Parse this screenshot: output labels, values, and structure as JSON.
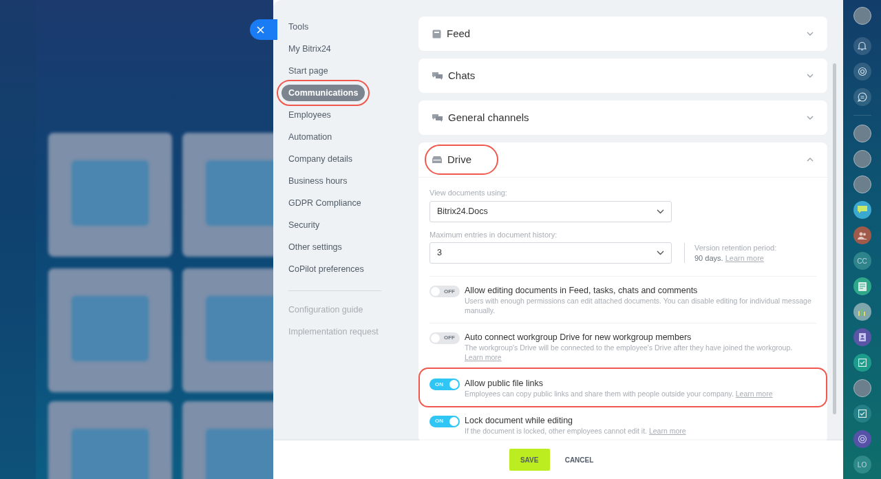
{
  "nav": {
    "items": [
      {
        "label": "Tools",
        "selected": false,
        "highlighted": false
      },
      {
        "label": "My Bitrix24",
        "selected": false,
        "highlighted": false
      },
      {
        "label": "Start page",
        "selected": false,
        "highlighted": false
      },
      {
        "label": "Communications",
        "selected": true,
        "highlighted": true
      },
      {
        "label": "Employees",
        "selected": false,
        "highlighted": false
      },
      {
        "label": "Automation",
        "selected": false,
        "highlighted": false
      },
      {
        "label": "Company details",
        "selected": false,
        "highlighted": false
      },
      {
        "label": "Business hours",
        "selected": false,
        "highlighted": false
      },
      {
        "label": "GDPR Compliance",
        "selected": false,
        "highlighted": false
      },
      {
        "label": "Security",
        "selected": false,
        "highlighted": false
      },
      {
        "label": "Other settings",
        "selected": false,
        "highlighted": false
      },
      {
        "label": "CoPilot preferences",
        "selected": false,
        "highlighted": false
      }
    ],
    "secondary": [
      "Configuration guide",
      "Implementation request"
    ]
  },
  "sections": [
    {
      "title": "Feed",
      "expanded": false,
      "highlighted": false
    },
    {
      "title": "Chats",
      "expanded": false,
      "highlighted": false
    },
    {
      "title": "General channels",
      "expanded": false,
      "highlighted": false
    },
    {
      "title": "Drive",
      "expanded": true,
      "highlighted": true,
      "body": {
        "fields": [
          {
            "label": "View documents using:",
            "value": "Bitrix24.Docs"
          },
          {
            "label": "Maximum entries in document history:",
            "value": "3"
          }
        ],
        "retention": {
          "label": "Version retention period:",
          "text": "90 days.",
          "link": "Learn more"
        },
        "toggles": [
          {
            "title": "Allow editing documents in Feed, tasks, chats and comments",
            "description": "Users with enough permissions can edit attached documents. You can disable editing for individual message manually.",
            "on": false,
            "switch_text": "OFF",
            "highlighted": false
          },
          {
            "title": "Auto connect workgroup Drive for new workgroup members",
            "description": "The workgroup's Drive will be connected to the employee's Drive after they have joined the workgroup.",
            "link": "Learn more",
            "on": false,
            "switch_text": "OFF",
            "highlighted": false
          },
          {
            "title": "Allow public file links",
            "description": "Employees can copy public links and share them with people outside your company.",
            "link": "Learn more",
            "on": true,
            "switch_text": "ON",
            "highlighted": true
          },
          {
            "title": "Lock document while editing",
            "description": "If the document is locked, other employees cannot edit it.",
            "link": "Learn more",
            "on": true,
            "switch_text": "ON",
            "highlighted": false
          }
        ]
      }
    }
  ],
  "footer": {
    "save": "SAVE",
    "cancel": "CANCEL"
  },
  "right_bar": {
    "initials": [
      "CC",
      "LO"
    ]
  }
}
